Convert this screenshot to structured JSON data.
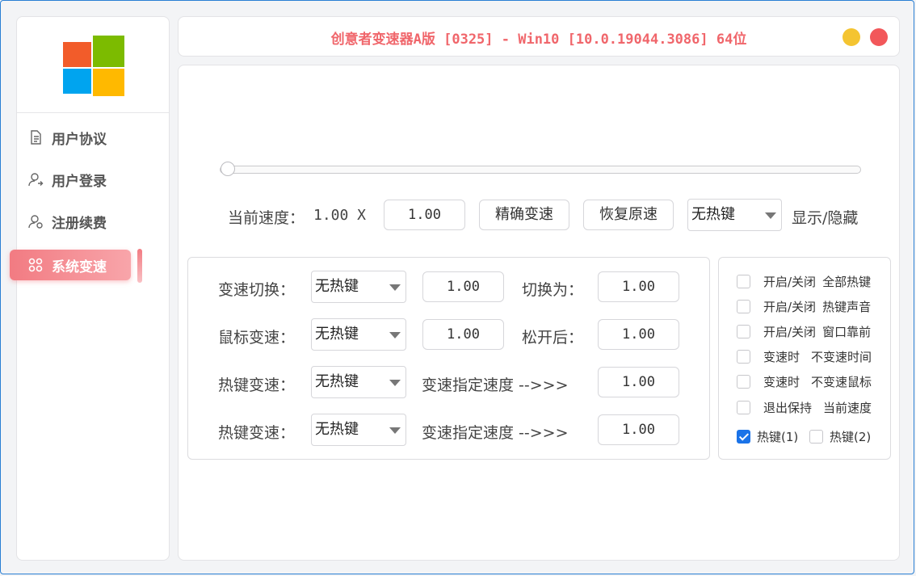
{
  "window": {
    "title": "创意者变速器A版 [0325]  - Win10 [10.0.19044.3086] 64位"
  },
  "sidebar": {
    "items": [
      {
        "label": "用户协议",
        "icon": "document-icon",
        "active": false
      },
      {
        "label": "用户登录",
        "icon": "user-login-icon",
        "active": false
      },
      {
        "label": "注册续费",
        "icon": "user-renew-icon",
        "active": false
      },
      {
        "label": "系统变速",
        "icon": "grid-icon",
        "active": true
      }
    ]
  },
  "main": {
    "slider": {
      "value": 1.0
    },
    "current_speed_label": "当前速度：",
    "current_speed_value": "1.00 X",
    "speed_input": "1.00",
    "precise_button": "精确变速",
    "restore_button": "恢复原速",
    "hotkey_select": "无热键",
    "show_hide_label": "显示/隐藏"
  },
  "speed_panel": {
    "row1": {
      "label": "变速切换：",
      "hotkey": "无热键",
      "value": "1.00",
      "to_label": "切换为：",
      "to_value": "1.00"
    },
    "row2": {
      "label": "鼠标变速：",
      "hotkey": "无热键",
      "value": "1.00",
      "to_label": "松开后：",
      "to_value": "1.00"
    },
    "row3": {
      "label": "热键变速：",
      "hotkey": "无热键",
      "to_label": "变速指定速度 -->>>",
      "to_value": "1.00"
    },
    "row4": {
      "label": "热键变速：",
      "hotkey": "无热键",
      "to_label": "变速指定速度 -->>>",
      "to_value": "1.00"
    }
  },
  "options": {
    "items": [
      {
        "a": "开启/关闭",
        "b": "全部热键",
        "checked": false
      },
      {
        "a": "开启/关闭",
        "b": "热键声音",
        "checked": false
      },
      {
        "a": "开启/关闭",
        "b": "窗口靠前",
        "checked": false
      },
      {
        "a": "变速时",
        "b": "不变速时间",
        "checked": false
      },
      {
        "a": "变速时",
        "b": "不变速鼠标",
        "checked": false
      },
      {
        "a": "退出保持",
        "b": "当前速度",
        "checked": false
      }
    ],
    "hotkey1": {
      "label": "热键(1)",
      "checked": true
    },
    "hotkey2": {
      "label": "热键(2)",
      "checked": false
    }
  },
  "colors": {
    "accent": "#f0666b",
    "minimize": "#f4c431",
    "close": "#f2575a",
    "check": "#1a73e8"
  }
}
